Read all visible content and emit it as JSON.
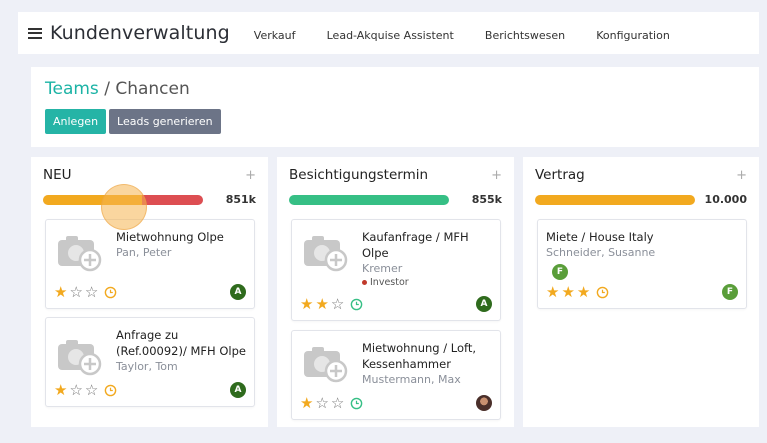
{
  "header": {
    "app_title": "Kundenverwaltung",
    "menu": [
      {
        "label": "Verkauf"
      },
      {
        "label": "Lead-Akquise Assistent"
      },
      {
        "label": "Berichtswesen"
      },
      {
        "label": "Konfiguration"
      }
    ]
  },
  "breadcrumb": {
    "parent": "Teams",
    "separator": " / ",
    "current": "Chancen"
  },
  "actions": {
    "create_label": "Anlegen",
    "generate_label": "Leads generieren"
  },
  "colors": {
    "teal": "#25b4a6",
    "orange": "#f2a91f",
    "red": "#dd4e52",
    "green": "#36bf85",
    "star": "#f2a91f"
  },
  "columns": [
    {
      "title": "NEU",
      "add": "+",
      "total": "851k",
      "progress": [
        {
          "color": "#f2a91f",
          "fraction": 0.62
        },
        {
          "color": "#dd4e52",
          "fraction": 0.38
        }
      ],
      "cards": [
        {
          "name": "Mietwohnung Olpe",
          "contact": "Pan, Peter",
          "stars": 1,
          "avatar": "A"
        },
        {
          "name": "Anfrage zu (Ref.00092)/ MFH Olpe",
          "contact": "Taylor, Tom",
          "stars": 1,
          "avatar": "A"
        }
      ]
    },
    {
      "title": "Besichtigungstermin",
      "add": "+",
      "total": "855k",
      "progress": [
        {
          "color": "#36bf85",
          "fraction": 1.0
        }
      ],
      "cards": [
        {
          "name": "Kaufanfrage / MFH Olpe",
          "contact": "Kremer",
          "tag": "Investor",
          "stars": 2,
          "avatar": "A"
        },
        {
          "name": "Mietwohnung / Loft, Kessenhammer",
          "contact": "Mustermann, Max",
          "stars": 1,
          "avatar": ""
        }
      ]
    },
    {
      "title": "Vertrag",
      "add": "+",
      "total": "10.000",
      "progress": [
        {
          "color": "#f2a91f",
          "fraction": 1.0
        }
      ],
      "cards": [
        {
          "name": "Miete / House Italy",
          "contact": "Schneider, Susanne",
          "stars": 3,
          "avatar": "F",
          "avatar_inline": "F"
        }
      ]
    }
  ]
}
